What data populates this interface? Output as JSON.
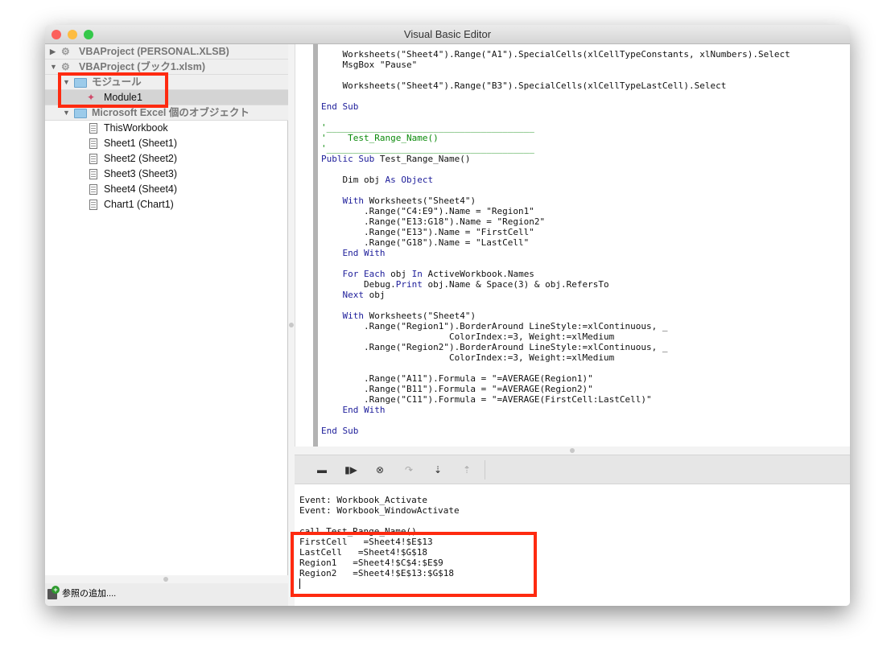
{
  "window": {
    "title": "Visual Basic Editor"
  },
  "project_tree": {
    "items": [
      {
        "label": "VBAProject (PERSONAL.XLSB)",
        "type": "project",
        "expanded": false,
        "level": 0
      },
      {
        "label": "VBAProject (ブック1.xlsm)",
        "type": "project",
        "expanded": true,
        "level": 0
      },
      {
        "label": "モジュール",
        "type": "folder",
        "expanded": true,
        "level": 1
      },
      {
        "label": "Module1",
        "type": "module",
        "selected": true,
        "level": 2
      },
      {
        "label": "Microsoft Excel 個のオブジェクト",
        "type": "folder",
        "expanded": true,
        "level": 1
      },
      {
        "label": "ThisWorkbook",
        "type": "document",
        "level": 2
      },
      {
        "label": "Sheet1 (Sheet1)",
        "type": "document",
        "level": 2
      },
      {
        "label": "Sheet2 (Sheet2)",
        "type": "document",
        "level": 2
      },
      {
        "label": "Sheet3 (Sheet3)",
        "type": "document",
        "level": 2
      },
      {
        "label": "Sheet4 (Sheet4)",
        "type": "document",
        "level": 2
      },
      {
        "label": "Chart1 (Chart1)",
        "type": "document",
        "level": 2
      }
    ],
    "add_reference_label": "参照の追加...."
  },
  "code_editor": {
    "lines": [
      [
        [
          "    Worksheets(\"Sheet4\").Range(\"A1\").SpecialCells(xlCellTypeConstants, xlNumbers).Select",
          ""
        ]
      ],
      [
        [
          "    MsgBox \"Pause\"",
          ""
        ]
      ],
      [
        [
          "",
          ""
        ]
      ],
      [
        [
          "    Worksheets(\"Sheet4\").Range(\"B3\").SpecialCells(xlCellTypeLastCell).Select",
          ""
        ]
      ],
      [
        [
          "",
          ""
        ]
      ],
      [
        [
          "End Sub",
          "kw"
        ]
      ],
      [
        [
          "",
          ""
        ]
      ],
      [
        [
          "'_______________________________________",
          "cm"
        ]
      ],
      [
        [
          "'    Test_Range_Name()",
          "cm"
        ]
      ],
      [
        [
          "'_______________________________________",
          "cm"
        ]
      ],
      [
        [
          "Public Sub ",
          "kw"
        ],
        [
          "Test_Range_Name()",
          ""
        ]
      ],
      [
        [
          "",
          ""
        ]
      ],
      [
        [
          "    ",
          ""
        ],
        [
          "Dim",
          ""
        ],
        [
          " obj ",
          ""
        ],
        [
          "As Object",
          "kw"
        ]
      ],
      [
        [
          "",
          ""
        ]
      ],
      [
        [
          "    ",
          ""
        ],
        [
          "With",
          "kw"
        ],
        [
          " Worksheets(\"Sheet4\")",
          ""
        ]
      ],
      [
        [
          "        .Range(\"C4:E9\").Name = \"Region1\"",
          ""
        ]
      ],
      [
        [
          "        .Range(\"E13:G18\").Name = \"Region2\"",
          ""
        ]
      ],
      [
        [
          "        .Range(\"E13\").Name = \"FirstCell\"",
          ""
        ]
      ],
      [
        [
          "        .Range(\"G18\").Name = \"LastCell\"",
          ""
        ]
      ],
      [
        [
          "    ",
          ""
        ],
        [
          "End With",
          "kw"
        ]
      ],
      [
        [
          "",
          ""
        ]
      ],
      [
        [
          "    ",
          ""
        ],
        [
          "For Each",
          "kw"
        ],
        [
          " obj ",
          ""
        ],
        [
          "In",
          "kw"
        ],
        [
          " ActiveWorkbook.Names",
          ""
        ]
      ],
      [
        [
          "        Debug.",
          ""
        ],
        [
          "Print",
          "kw"
        ],
        [
          " obj.Name & Space(3) & obj.RefersTo",
          ""
        ]
      ],
      [
        [
          "    ",
          ""
        ],
        [
          "Next",
          "kw"
        ],
        [
          " obj",
          ""
        ]
      ],
      [
        [
          "",
          ""
        ]
      ],
      [
        [
          "    ",
          ""
        ],
        [
          "With",
          "kw"
        ],
        [
          " Worksheets(\"Sheet4\")",
          ""
        ]
      ],
      [
        [
          "        .Range(\"Region1\").BorderAround LineStyle:=xlContinuous, _",
          ""
        ]
      ],
      [
        [
          "                        ColorIndex:=3, Weight:=xlMedium",
          ""
        ]
      ],
      [
        [
          "        .Range(\"Region2\").BorderAround LineStyle:=xlContinuous, _",
          ""
        ]
      ],
      [
        [
          "                        ColorIndex:=3, Weight:=xlMedium",
          ""
        ]
      ],
      [
        [
          "",
          ""
        ]
      ],
      [
        [
          "        .Range(\"A11\").Formula = \"=AVERAGE(Region1)\"",
          ""
        ]
      ],
      [
        [
          "        .Range(\"B11\").Formula = \"=AVERAGE(Region2)\"",
          ""
        ]
      ],
      [
        [
          "        .Range(\"C11\").Formula = \"=AVERAGE(FirstCell:LastCell)\"",
          ""
        ]
      ],
      [
        [
          "    ",
          ""
        ],
        [
          "End With",
          "kw"
        ]
      ],
      [
        [
          "",
          ""
        ]
      ],
      [
        [
          "End Sub",
          "kw"
        ]
      ]
    ]
  },
  "debug_toolbar": [
    {
      "name": "break-icon",
      "glyph": "▬",
      "enabled": true
    },
    {
      "name": "run-icon",
      "glyph": "▮▶",
      "enabled": true
    },
    {
      "name": "reset-icon",
      "glyph": "⊗",
      "enabled": true
    },
    {
      "name": "step-over-icon",
      "glyph": "↷",
      "enabled": false
    },
    {
      "name": "step-into-icon",
      "glyph": "⇣",
      "enabled": true
    },
    {
      "name": "step-out-icon",
      "glyph": "⇡",
      "enabled": false
    }
  ],
  "immediate_window": {
    "lines": [
      "Event: Workbook_Activate",
      "Event: Workbook_WindowActivate",
      "",
      "call Test_Range_Name()",
      "FirstCell   =Sheet4!$E$13",
      "LastCell   =Sheet4!$G$18",
      "Region1   =Sheet4!$C$4:$E$9",
      "Region2   =Sheet4!$E$13:$G$18"
    ]
  },
  "colors": {
    "highlight_box": "#fe2a10",
    "keyword": "#1d1d9a",
    "comment": "#0b8a0b",
    "selection": "#d4d4d4"
  }
}
